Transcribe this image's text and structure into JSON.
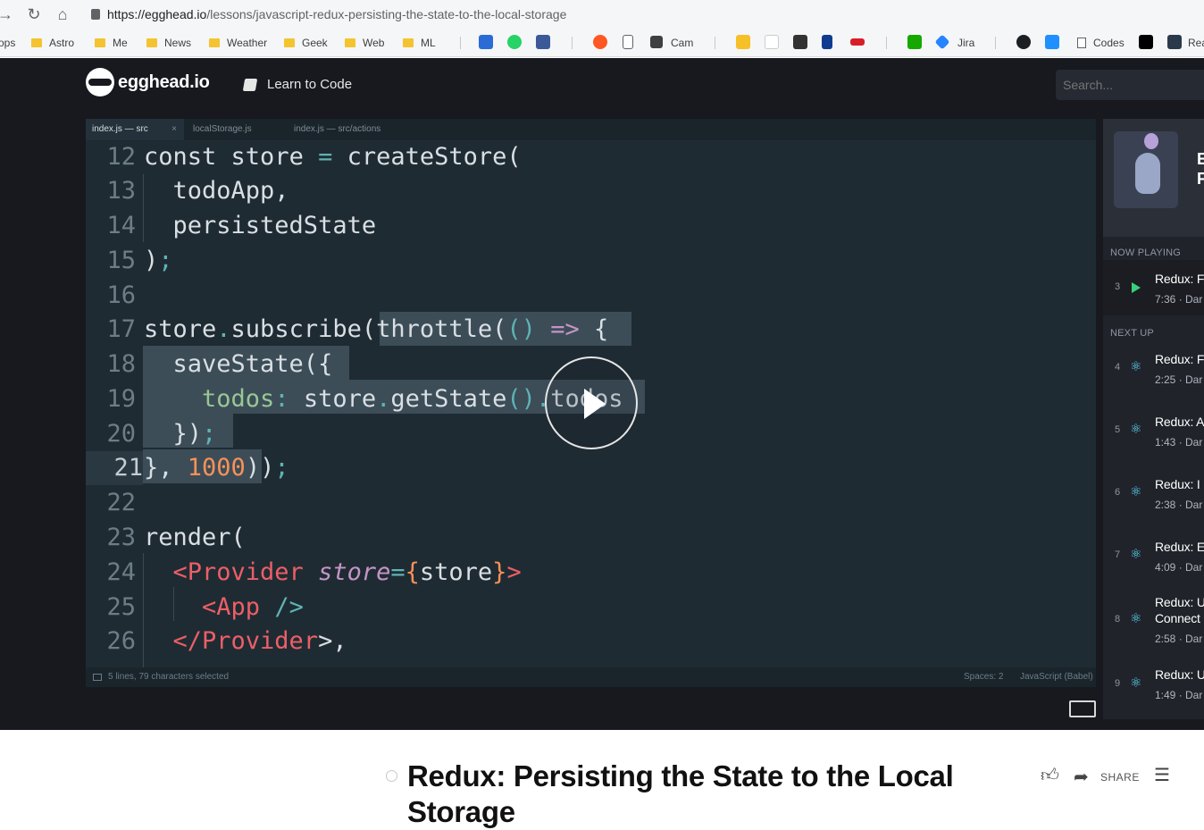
{
  "browser": {
    "url_domain": "https://egghead.io",
    "url_path": "/lessons/javascript-redux-persisting-the-state-to-the-local-storage",
    "bookmarks": [
      "ops",
      "Astro",
      "Me",
      "News",
      "Weather",
      "Geek",
      "Web",
      "ML",
      "Cam",
      "Jira",
      "Codes",
      "Rea"
    ]
  },
  "site": {
    "logo": "egghead.io",
    "learn_label": "Learn to Code",
    "search_placeholder": "Search..."
  },
  "editor": {
    "tabs": [
      "index.js — src",
      "localStorage.js",
      "index.js — src/actions"
    ],
    "tab_close": "×",
    "line_numbers": [
      "12",
      "13",
      "14",
      "15",
      "16",
      "17",
      "18",
      "19",
      "20",
      "21",
      "22",
      "23",
      "24",
      "25",
      "26"
    ],
    "status_left": "5 lines, 79 characters selected",
    "status_spaces": "Spaces: 2",
    "status_lang": "JavaScript (Babel)"
  },
  "sidebar": {
    "course_title_line1": "E",
    "course_title_line2": "F",
    "now_playing_label": "NOW PLAYING",
    "next_up_label": "NEXT UP",
    "now_playing": {
      "num": "3",
      "title": "Redux: F",
      "meta": "7:36 · Dar"
    },
    "next_up": [
      {
        "num": "4",
        "title": "Redux: F",
        "meta": "2:25 · Dar"
      },
      {
        "num": "5",
        "title": "Redux: A",
        "meta": "1:43 · Dar"
      },
      {
        "num": "6",
        "title": "Redux: I",
        "meta": "2:38 · Dar"
      },
      {
        "num": "7",
        "title": "Redux: E",
        "meta": "4:09 · Dar"
      },
      {
        "num": "8",
        "title": "Redux: U",
        "title2": "Connect",
        "meta": "2:58 · Dar"
      },
      {
        "num": "9",
        "title": "Redux: U",
        "meta": "1:49 · Dar"
      }
    ]
  },
  "lesson": {
    "title": "Redux: Persisting the State to the Local Storage",
    "share_label": "SHARE"
  }
}
